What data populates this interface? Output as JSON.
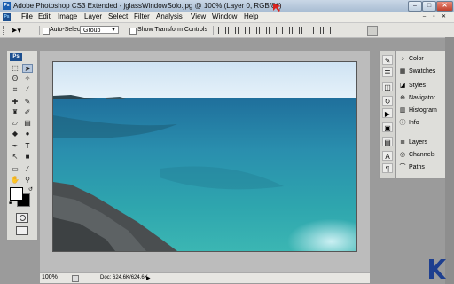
{
  "window": {
    "title": "Adobe Photoshop CS3 Extended - jglassWindowSolo.jpg @ 100% (Layer 0, RGB/8#)",
    "minimize": "–",
    "maximize": "□",
    "close": "✕"
  },
  "menu": [
    "File",
    "Edit",
    "Image",
    "Layer",
    "Select",
    "Filter",
    "Analysis",
    "View",
    "Window",
    "Help"
  ],
  "options": {
    "auto_select_label": "Auto-Select:",
    "group_value": "Group",
    "show_transform_label": "Show Transform Controls"
  },
  "toolbox": {
    "badge": "Ps"
  },
  "status": {
    "zoom": "100%",
    "doc": "Doc: 624.6K/624.6K"
  },
  "panels": [
    {
      "label": "Color",
      "icon": "color-icon"
    },
    {
      "label": "Swatches",
      "icon": "swatches-icon"
    },
    {
      "label": "Styles",
      "icon": "styles-icon"
    },
    {
      "label": "Navigator",
      "icon": "navigator-icon"
    },
    {
      "label": "Histogram",
      "icon": "histogram-icon"
    },
    {
      "label": "Info",
      "icon": "info-icon"
    },
    {
      "label": "Layers",
      "icon": "layers-icon"
    },
    {
      "label": "Channels",
      "icon": "channels-icon"
    },
    {
      "label": "Paths",
      "icon": "paths-icon"
    }
  ],
  "colors": {
    "foreground": "#ffffff",
    "background": "#000000",
    "accent": "#1c4f8f"
  }
}
